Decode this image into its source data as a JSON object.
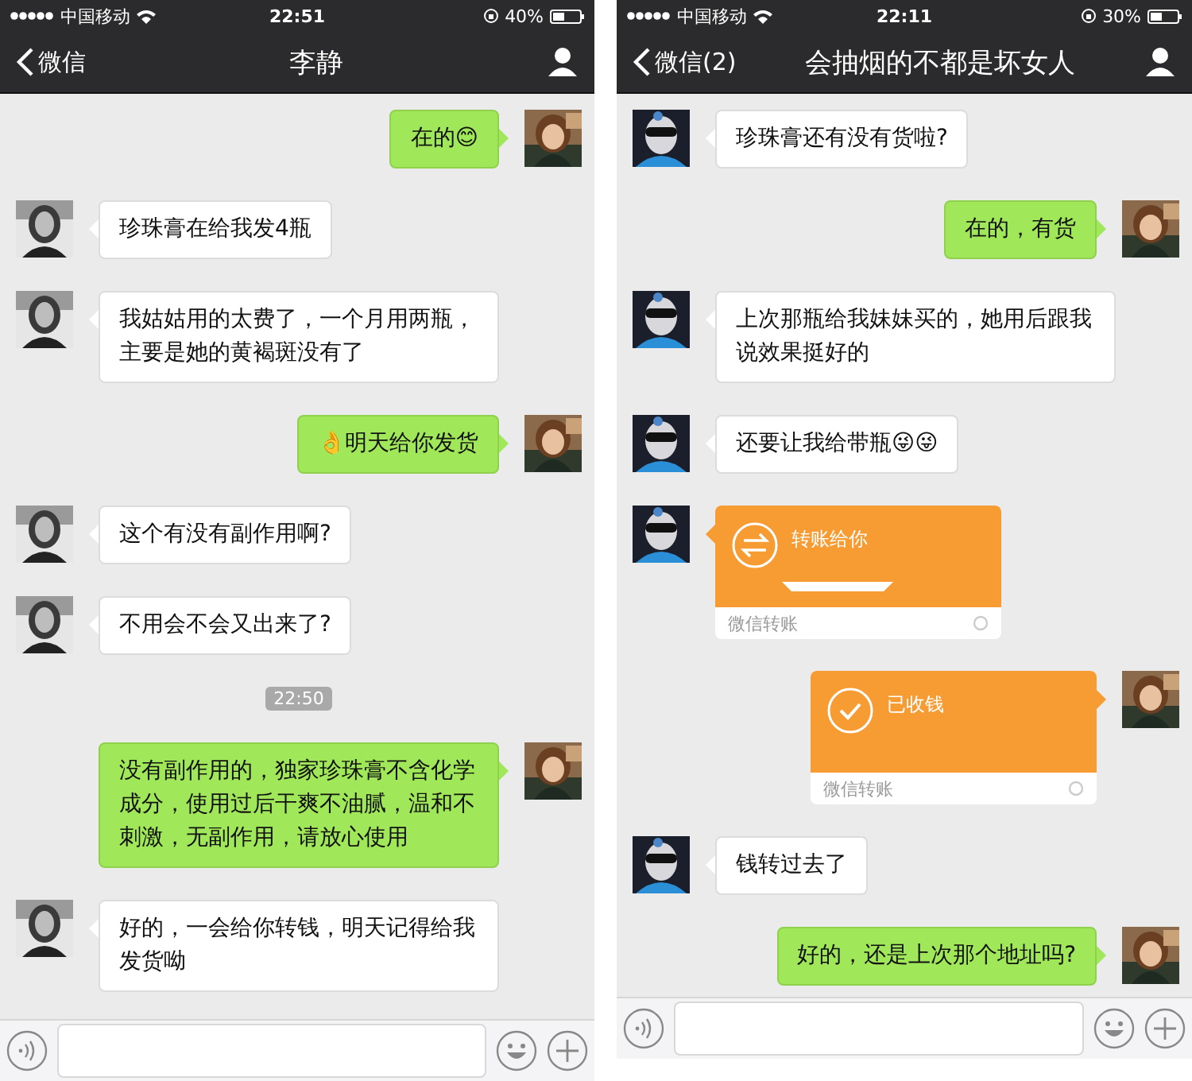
{
  "phones": [
    {
      "status_bar": {
        "carrier": "中国移动",
        "time": "22:51",
        "battery": "40%"
      },
      "nav": {
        "back": "微信",
        "title": "李静"
      },
      "messages": [
        {
          "kind": "text",
          "outgoing": true,
          "text": "在的😊"
        },
        {
          "kind": "text",
          "outgoing": false,
          "text": "珍珠膏在给我发4瓶"
        },
        {
          "kind": "text",
          "outgoing": false,
          "text": "我姑姑用的太费了，一个月用两瓶，主要是她的黄褐斑没有了"
        },
        {
          "kind": "text",
          "outgoing": true,
          "text": "👌明天给你发货"
        },
        {
          "kind": "text",
          "outgoing": false,
          "text": "这个有没有副作用啊?"
        },
        {
          "kind": "text",
          "outgoing": false,
          "text": "不用会不会又出来了?"
        },
        {
          "kind": "time",
          "text": "22:50"
        },
        {
          "kind": "text",
          "outgoing": true,
          "text": "没有副作用的，独家珍珠膏不含化学成分，使用过后干爽不油腻，温和不刺激，无副作用，请放心使用"
        },
        {
          "kind": "text",
          "outgoing": false,
          "text": "好的，一会给你转钱，明天记得给我发货呦"
        }
      ]
    },
    {
      "status_bar": {
        "carrier": "中国移动",
        "time": "22:11",
        "battery": "30%"
      },
      "nav": {
        "back": "微信(2)",
        "title": "会抽烟的不都是坏女人"
      },
      "messages": [
        {
          "kind": "text",
          "outgoing": false,
          "text": "珍珠膏还有没有货啦?"
        },
        {
          "kind": "text",
          "outgoing": true,
          "text": "在的，有货"
        },
        {
          "kind": "text",
          "outgoing": false,
          "text": "上次那瓶给我妹妹买的，她用后跟我说效果挺好的"
        },
        {
          "kind": "text",
          "outgoing": false,
          "text": "还要让我给带瓶😜😜"
        },
        {
          "kind": "transfer",
          "outgoing": false,
          "text": "转账给你",
          "footer": "微信转账",
          "received": false
        },
        {
          "kind": "transfer",
          "outgoing": true,
          "text": "已收钱",
          "footer": "微信转账",
          "received": true
        },
        {
          "kind": "text",
          "outgoing": false,
          "text": "钱转过去了"
        },
        {
          "kind": "text",
          "outgoing": true,
          "text": "好的，还是上次那个地址吗?"
        }
      ]
    }
  ]
}
